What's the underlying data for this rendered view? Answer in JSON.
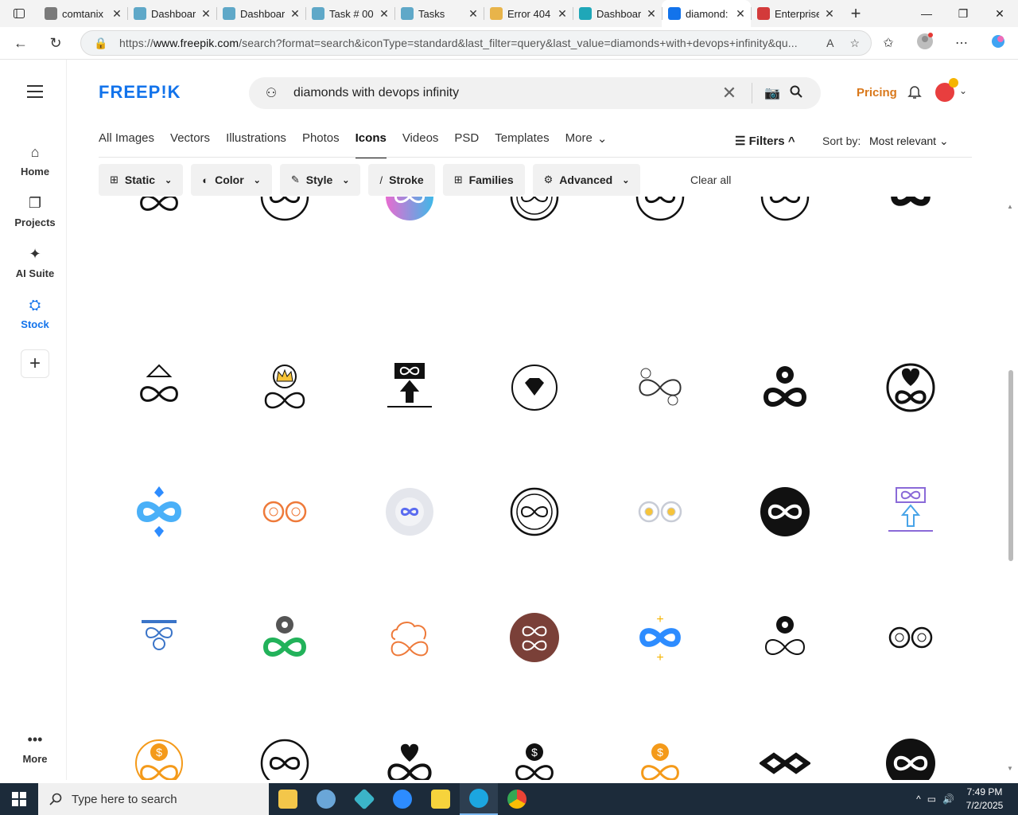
{
  "browser": {
    "tabs": [
      {
        "title": "comtanix",
        "color": "#7a7a7a"
      },
      {
        "title": "Dashboar",
        "color": "#5fa8c8"
      },
      {
        "title": "Dashboar",
        "color": "#5fa8c8"
      },
      {
        "title": "Task # 00",
        "color": "#5fa8c8"
      },
      {
        "title": "Tasks",
        "color": "#5fa8c8"
      },
      {
        "title": "Error 404",
        "color": "#e8b44a"
      },
      {
        "title": "Dashboar",
        "color": "#1fa7b8"
      },
      {
        "title": "diamond:",
        "color": "#1273eb"
      },
      {
        "title": "Enterprise",
        "color": "#d33a3a"
      }
    ],
    "close_glyph": "✕",
    "new_tab_glyph": "+",
    "url_prefix": "https://",
    "url_host": "www.freepik.com",
    "url_rest": "/search?format=search&iconType=standard&last_filter=query&last_value=diamonds+with+devops+infinity&qu..."
  },
  "freepik": {
    "logo": "FREEP!K",
    "search_value": "diamonds with devops infinity",
    "pricing": "Pricing",
    "nav": [
      {
        "label": "Home",
        "icon": "⌂"
      },
      {
        "label": "Projects",
        "icon": "❐"
      },
      {
        "label": "AI Suite",
        "icon": "✦"
      },
      {
        "label": "Stock",
        "icon": "⛭"
      },
      {
        "label": "More",
        "icon": "•••"
      }
    ],
    "type_tabs": [
      "All Images",
      "Vectors",
      "Illustrations",
      "Photos",
      "Icons",
      "Videos",
      "PSD",
      "Templates",
      "More"
    ],
    "active_type_tab": "Icons",
    "filters_label": "Filters",
    "sort_label": "Sort by:",
    "sort_value": "Most relevant",
    "chips": [
      {
        "label": "Static",
        "icon": "⊞"
      },
      {
        "label": "Color",
        "icon": "◐"
      },
      {
        "label": "Style",
        "icon": "✎"
      },
      {
        "label": "Stroke",
        "icon": "/"
      },
      {
        "label": "Families",
        "icon": "⊞"
      },
      {
        "label": "Advanced",
        "icon": "⚙"
      }
    ],
    "clear_all": "Clear all",
    "icon_rows": [
      [
        "infinity-triangle-outline",
        "infinity-circle-outline",
        "infinity-gradient-circle",
        "infinity-badge-outline",
        "infinity-circle-outline",
        "infinity-circle-outline",
        "infinity-diamond-solid"
      ],
      [
        "infinity-triangle-outline",
        "crown-infinity-outline",
        "infinity-arrow-up-flow",
        "diamond-cycle-outline",
        "infinity-currency-outline",
        "gear-infinity-solid",
        "heart-infinity-circle"
      ],
      [
        "infinity-diamond-blue",
        "gears-infinity-orange",
        "gear-infinity-grey",
        "infinity-cycle-outline",
        "gears-infinity-light",
        "infinity-stars-badge",
        "infinity-arrow-flow-color"
      ],
      [
        "infinity-stack-blue",
        "gear-infinity-green",
        "cloud-infinity-orange",
        "double-infinity-circle",
        "infinity-plus-blue",
        "gear-infinity-arrows",
        "gears-cycle-outline"
      ],
      [
        "dollar-infinity-orange",
        "infinity-circle-outline",
        "heart-infinity-solid",
        "dollar-infinity-black",
        "dollar-infinity-gold",
        "infinity-chain-solid",
        "infinity-circle-solid"
      ]
    ]
  },
  "taskbar": {
    "search_placeholder": "Type here to search",
    "time": "7:49 PM",
    "date": "7/2/2025"
  }
}
